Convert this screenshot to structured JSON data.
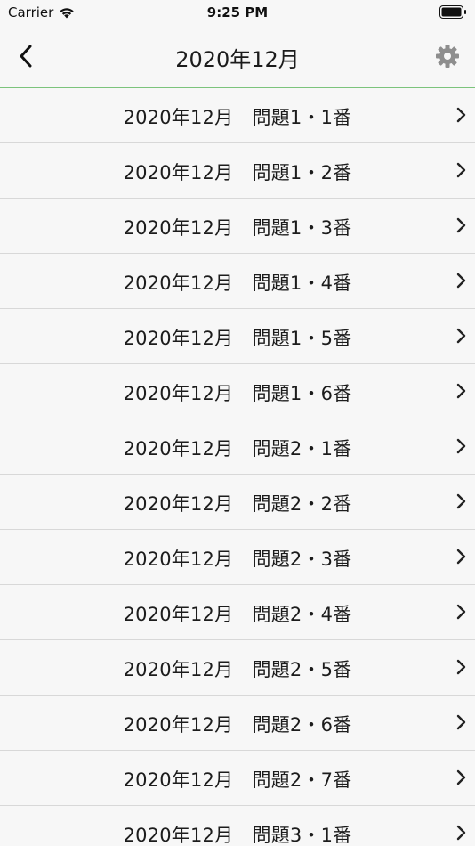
{
  "status_bar": {
    "carrier": "Carrier",
    "time": "9:25 PM",
    "wifi_icon": "wifi-icon",
    "battery_icon": "battery-icon"
  },
  "nav": {
    "title": "2020年12月",
    "back_icon": "chevron-left-icon",
    "settings_icon": "gear-icon"
  },
  "list": {
    "items": [
      {
        "label": "2020年12月　問題1・1番"
      },
      {
        "label": "2020年12月　問題1・2番"
      },
      {
        "label": "2020年12月　問題1・3番"
      },
      {
        "label": "2020年12月　問題1・4番"
      },
      {
        "label": "2020年12月　問題1・5番"
      },
      {
        "label": "2020年12月　問題1・6番"
      },
      {
        "label": "2020年12月　問題2・1番"
      },
      {
        "label": "2020年12月　問題2・2番"
      },
      {
        "label": "2020年12月　問題2・3番"
      },
      {
        "label": "2020年12月　問題2・4番"
      },
      {
        "label": "2020年12月　問題2・5番"
      },
      {
        "label": "2020年12月　問題2・6番"
      },
      {
        "label": "2020年12月　問題2・7番"
      },
      {
        "label": "2020年12月　問題3・1番"
      }
    ],
    "chevron_icon": "chevron-right-icon"
  },
  "colors": {
    "accent_line": "#7cc47c",
    "background": "#f7f7f7",
    "separator": "#d8d8d8"
  }
}
